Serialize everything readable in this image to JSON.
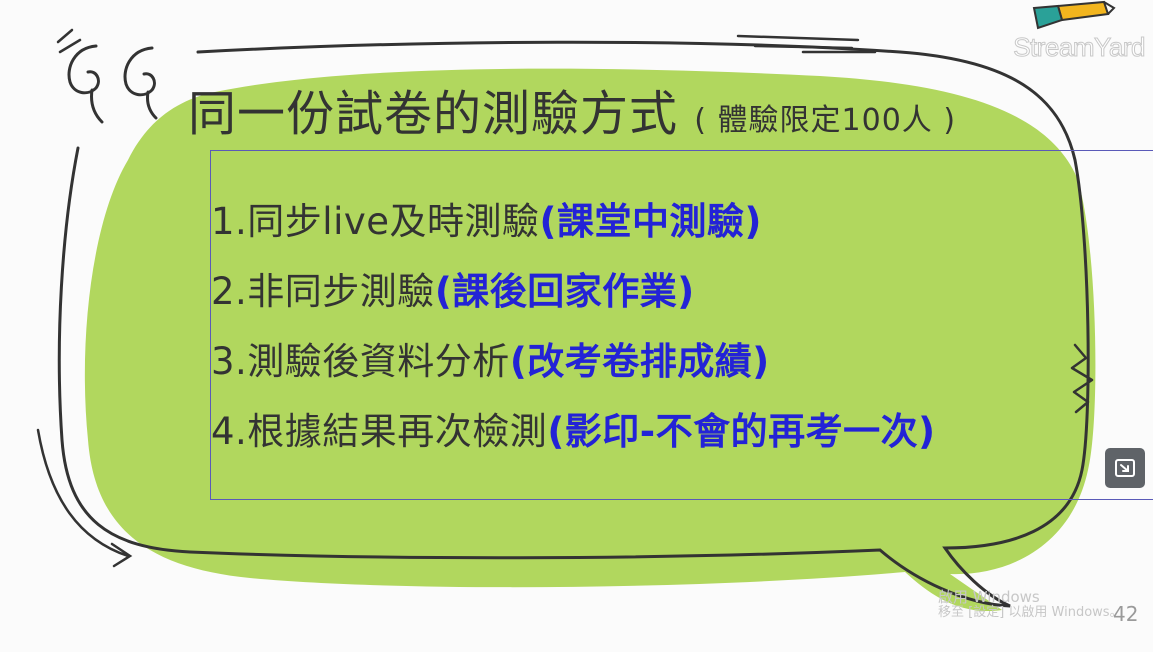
{
  "slide": {
    "title": "同一份試卷的測驗方式",
    "title_suffix": "( 體驗限定100人 )",
    "items": [
      {
        "text": "1.同步live及時測驗",
        "note": "(課堂中測驗)"
      },
      {
        "text": "2.非同步測驗",
        "note": "(課後回家作業)"
      },
      {
        "text": "3.測驗後資料分析",
        "note": "(改考卷排成績)"
      },
      {
        "text": "4.根據結果再次檢測",
        "note": "(影印-不會的再考一次)"
      }
    ],
    "page_number": "42"
  },
  "overlay": {
    "brand": "StreamYard",
    "watermark_line1": "啟用 Windows",
    "watermark_line2": "移至 [設定] 以啟用 Windows。"
  },
  "icons": {
    "quote": "quote-marks-icon",
    "expand": "expand-icon",
    "pencil": "pencil-icon"
  },
  "colors": {
    "bubble_green": "#b1d75e",
    "note_blue": "#2323d6",
    "text": "#333333",
    "box_border": "#5a5ab8"
  }
}
